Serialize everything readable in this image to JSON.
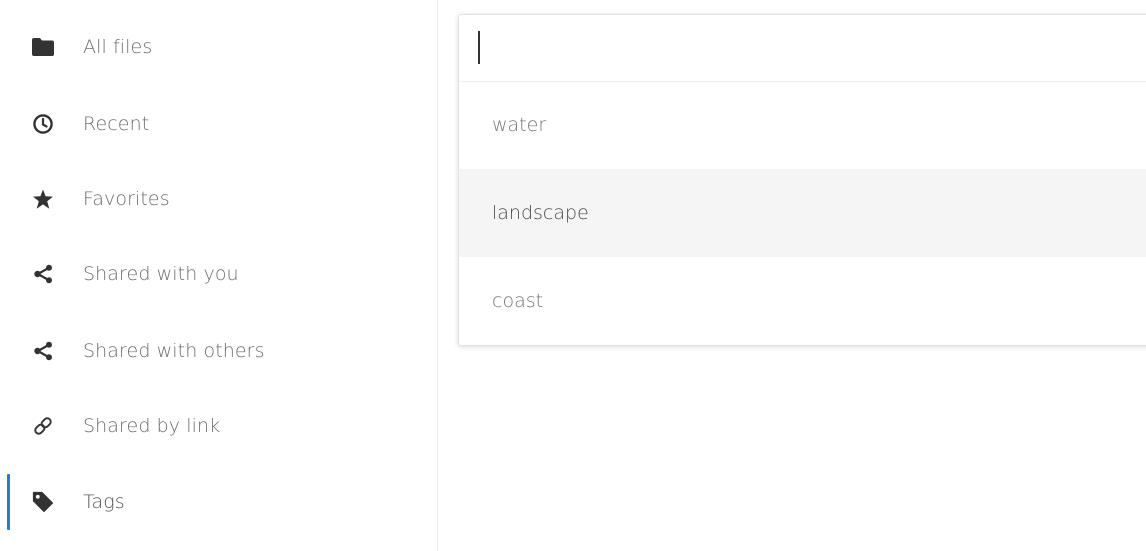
{
  "sidebar": {
    "items": [
      {
        "id": "all-files",
        "label": "All files",
        "icon": "folder-icon"
      },
      {
        "id": "recent",
        "label": "Recent",
        "icon": "clock-icon"
      },
      {
        "id": "favorites",
        "label": "Favorites",
        "icon": "star-icon"
      },
      {
        "id": "shared-with-you",
        "label": "Shared with you",
        "icon": "share-icon"
      },
      {
        "id": "shared-with-others",
        "label": "Shared with others",
        "icon": "share-icon"
      },
      {
        "id": "shared-by-link",
        "label": "Shared by link",
        "icon": "link-icon"
      },
      {
        "id": "tags",
        "label": "Tags",
        "icon": "tag-icon",
        "active": true
      }
    ]
  },
  "tag_search": {
    "value": "",
    "options": [
      {
        "label": "water"
      },
      {
        "label": "landscape",
        "highlighted": true
      },
      {
        "label": "coast"
      }
    ]
  },
  "colors": {
    "active_indicator": "#1f7ecf",
    "text": "#6d6d6d",
    "highlight_bg": "#f5f5f5",
    "icon": "#333333"
  }
}
